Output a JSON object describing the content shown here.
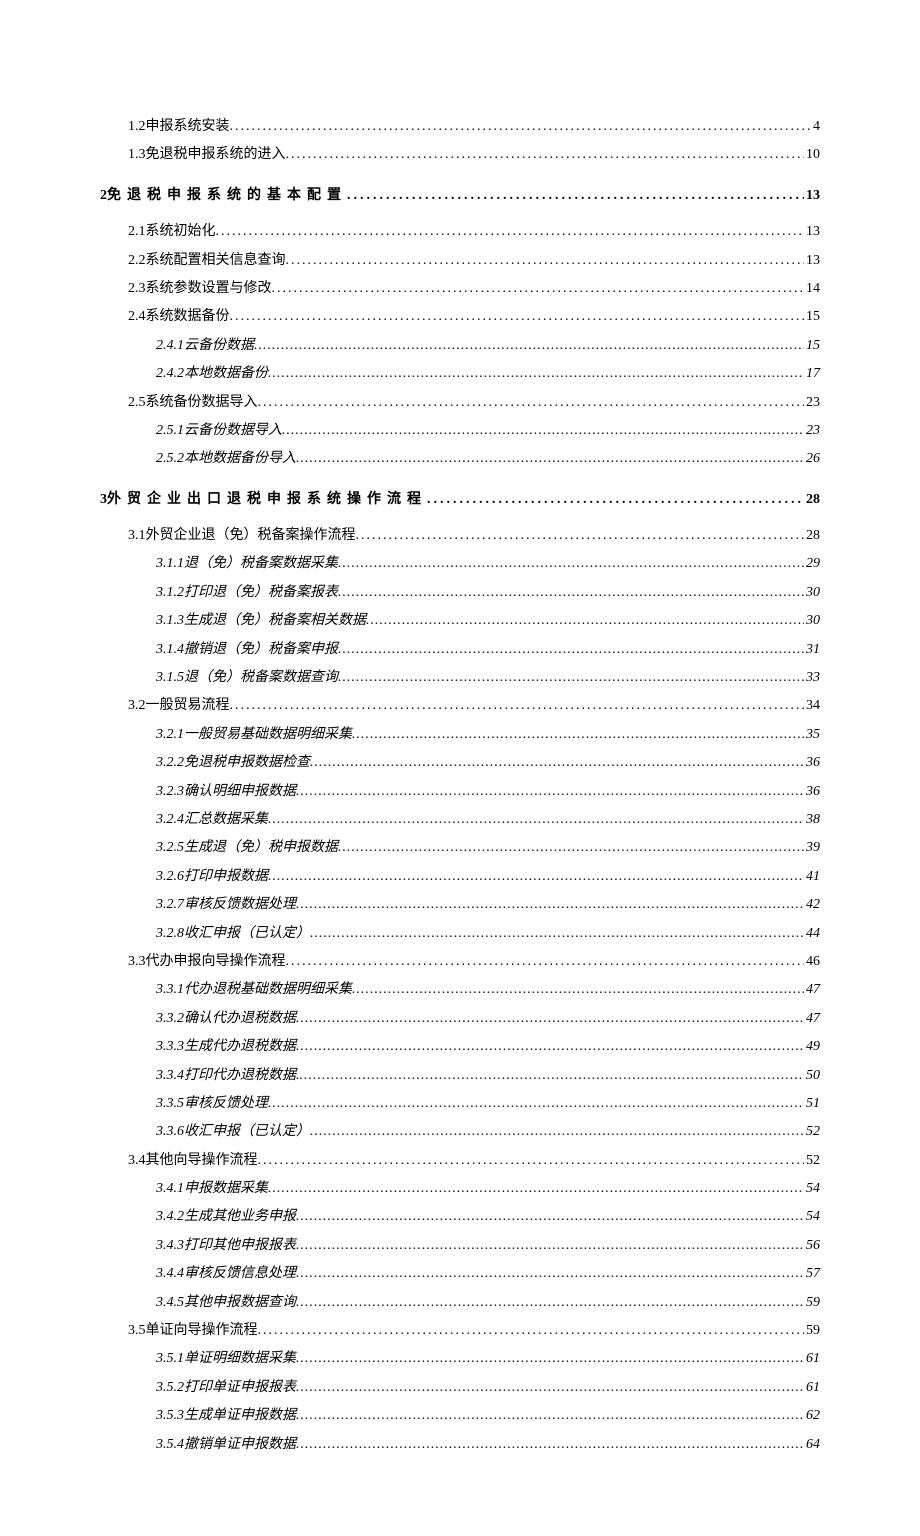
{
  "toc": [
    {
      "level": 2,
      "num": "1.2",
      "title": " 申报系统安装 ",
      "page": "4"
    },
    {
      "level": 2,
      "num": "1.3",
      "title": " 免退税申报系统的进入 ",
      "page": "10"
    },
    {
      "level": 1,
      "num": "2",
      "title": " 免退税申报系统的基本配置",
      "page": "13"
    },
    {
      "level": 2,
      "num": "2.1",
      "title": " 系统初始化 ",
      "page": "13"
    },
    {
      "level": 2,
      "num": "2.2",
      "title": " 系统配置相关信息查询 ",
      "page": "13"
    },
    {
      "level": 2,
      "num": "2.3",
      "title": " 系统参数设置与修改 ",
      "page": "14"
    },
    {
      "level": 2,
      "num": "2.4",
      "title": " 系统数据备份 ",
      "page": "15"
    },
    {
      "level": 3,
      "num": "2.4.1",
      "title": " 云备份数据 ",
      "page": "15"
    },
    {
      "level": 3,
      "num": "2.4.2",
      "title": " 本地数据备份 ",
      "page": "17"
    },
    {
      "level": 2,
      "num": "2.5",
      "title": " 系统备份数据导入 ",
      "page": "23"
    },
    {
      "level": 3,
      "num": "2.5.1",
      "title": " 云备份数据导入 ",
      "page": "23"
    },
    {
      "level": 3,
      "num": "2.5.2",
      "title": " 本地数据备份导入 ",
      "page": "26"
    },
    {
      "level": 1,
      "num": "3",
      "title": " 外贸企业出口退税申报系统操作流程",
      "page": "28"
    },
    {
      "level": 2,
      "num": "3.1",
      "title": " 外贸企业退（免）税备案操作流程 ",
      "page": "28"
    },
    {
      "level": 3,
      "num": "3.1.1",
      "title": " 退（免）税备案数据采集 ",
      "page": "29"
    },
    {
      "level": 3,
      "num": "3.1.2",
      "title": " 打印退（免）税备案报表 ",
      "page": "30"
    },
    {
      "level": 3,
      "num": "3.1.3",
      "title": " 生成退（免）税备案相关数据 ",
      "page": "30"
    },
    {
      "level": 3,
      "num": "3.1.4",
      "title": " 撤销退（免）税备案申报 ",
      "page": "31"
    },
    {
      "level": 3,
      "num": "3.1.5",
      "title": " 退（免）税备案数据查询 ",
      "page": "33"
    },
    {
      "level": 2,
      "num": "3.2",
      "title": " 一般贸易流程 ",
      "page": "34"
    },
    {
      "level": 3,
      "num": "3.2.1",
      "title": " 一般贸易基础数据明细采集 ",
      "page": "35"
    },
    {
      "level": 3,
      "num": "3.2.2",
      "title": " 免退税申报数据检查 ",
      "page": "36"
    },
    {
      "level": 3,
      "num": "3.2.3",
      "title": " 确认明细申报数据 ",
      "page": "36"
    },
    {
      "level": 3,
      "num": "3.2.4",
      "title": " 汇总数据采集 ",
      "page": "38"
    },
    {
      "level": 3,
      "num": "3.2.5",
      "title": " 生成退（免）税申报数据 ",
      "page": "39"
    },
    {
      "level": 3,
      "num": "3.2.6",
      "title": " 打印申报数据 ",
      "page": "41"
    },
    {
      "level": 3,
      "num": "3.2.7",
      "title": " 审核反馈数据处理 ",
      "page": "42"
    },
    {
      "level": 3,
      "num": "3.2.8",
      "title": " 收汇申报（已认定） ",
      "page": "44"
    },
    {
      "level": 2,
      "num": "3.3",
      "title": " 代办申报向导操作流程 ",
      "page": "46"
    },
    {
      "level": 3,
      "num": "3.3.1",
      "title": " 代办退税基础数据明细采集 ",
      "page": "47"
    },
    {
      "level": 3,
      "num": "3.3.2",
      "title": " 确认代办退税数据 ",
      "page": "47"
    },
    {
      "level": 3,
      "num": "3.3.3",
      "title": " 生成代办退税数据 ",
      "page": "49"
    },
    {
      "level": 3,
      "num": "3.3.4",
      "title": " 打印代办退税数据. ",
      "page": "50"
    },
    {
      "level": 3,
      "num": "3.3.5",
      "title": " 审核反馈处理 ",
      "page": "51"
    },
    {
      "level": 3,
      "num": "3.3.6",
      "title": " 收汇申报（已认定） ",
      "page": "52"
    },
    {
      "level": 2,
      "num": "3.4",
      "title": " 其他向导操作流程 ",
      "page": "52"
    },
    {
      "level": 3,
      "num": "3.4.1",
      "title": " 申报数据采集 ",
      "page": "54"
    },
    {
      "level": 3,
      "num": "3.4.2",
      "title": " 生成其他业务申报 ",
      "page": "54"
    },
    {
      "level": 3,
      "num": "3.4.3",
      "title": " 打印其他申报报表 ",
      "page": "56"
    },
    {
      "level": 3,
      "num": "3.4.4",
      "title": " 审核反馈信息处理 ",
      "page": "57"
    },
    {
      "level": 3,
      "num": "3.4.5",
      "title": " 其他申报数据查询 ",
      "page": "59"
    },
    {
      "level": 2,
      "num": "3.5",
      "title": " 单证向导操作流程 ",
      "page": "59"
    },
    {
      "level": 3,
      "num": "3.5.1",
      "title": " 单证明细数据采集 ",
      "page": "61"
    },
    {
      "level": 3,
      "num": "3.5.2",
      "title": " 打印单证申报报表 ",
      "page": "61"
    },
    {
      "level": 3,
      "num": "3.5.3",
      "title": " 生成单证申报数据 ",
      "page": "62"
    },
    {
      "level": 3,
      "num": "3.5.4",
      "title": " 撤销单证申报数据 ",
      "page": "64"
    }
  ]
}
